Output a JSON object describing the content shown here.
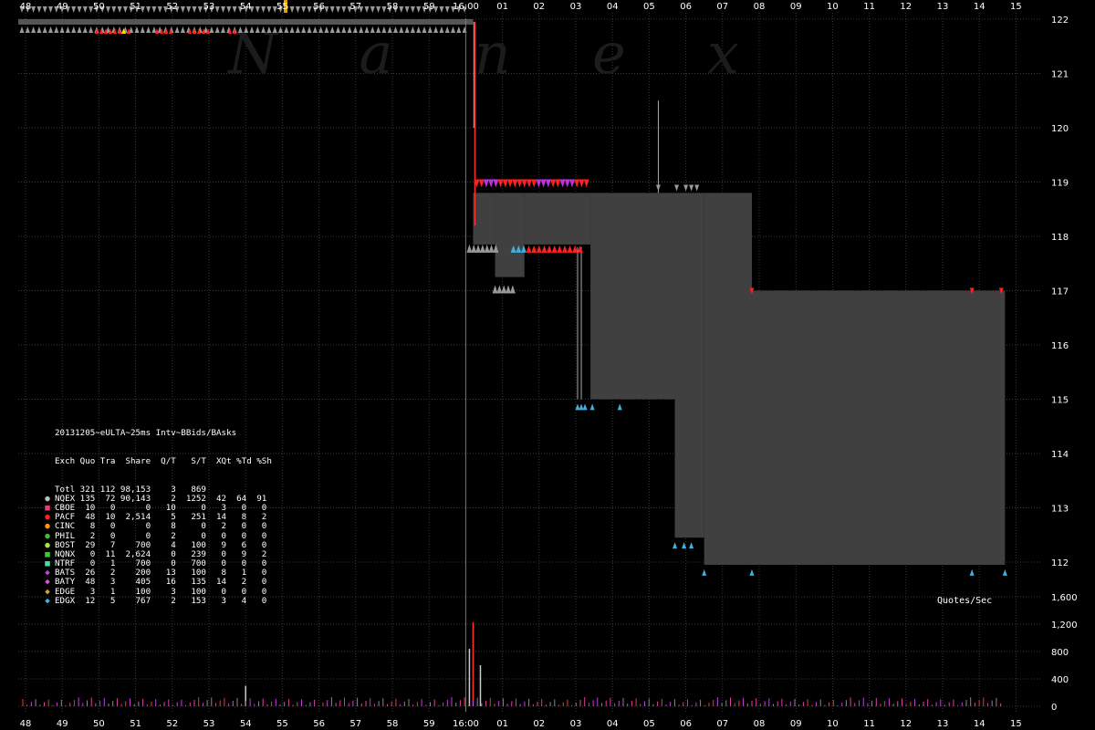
{
  "chart_data": {
    "type": "scatter",
    "title": "",
    "watermark": "Nanex",
    "x_tick_labels": [
      "48",
      "49",
      "50",
      "51",
      "52",
      "53",
      "54",
      "55",
      "56",
      "57",
      "58",
      "59",
      "16:00",
      "01",
      "02",
      "03",
      "04",
      "05",
      "06",
      "07",
      "08",
      "09",
      "10",
      "11",
      "12",
      "13",
      "14",
      "15"
    ],
    "y_tick_labels": [
      "122",
      "121",
      "120",
      "119",
      "118",
      "117",
      "116",
      "115",
      "114",
      "113",
      "112"
    ],
    "volume_tick_labels": [
      "1,600",
      "1,200",
      "800",
      "400",
      "0"
    ],
    "price_ylim": [
      112,
      122
    ],
    "volume_ylim": [
      0,
      1600
    ],
    "nbbo": {
      "bid_steps": [
        {
          "from": "16:00:00.2",
          "to": "16:00:00.8",
          "bid": 117.85,
          "ask": 118.8
        },
        {
          "from": "16:00:00.8",
          "to": "16:00:01.6",
          "bid": 117.25,
          "ask": 118.8
        },
        {
          "from": "16:00:01.6",
          "to": "16:00:03.4",
          "bid": 117.85,
          "ask": 118.8
        },
        {
          "from": "16:00:03.4",
          "to": "16:00:05.7",
          "bid": 115.0,
          "ask": 118.8
        },
        {
          "from": "16:00:05.7",
          "to": "16:00:06.5",
          "bid": 112.45,
          "ask": 118.8
        },
        {
          "from": "16:00:06.5",
          "to": "16:00:07.8",
          "bid": 111.95,
          "ask": 118.8
        },
        {
          "from": "16:00:07.8",
          "to": "16:00:14.7",
          "bid": 111.95,
          "ask": 117.0
        }
      ]
    },
    "pre_close_price": 121.95,
    "volume_spikes": [
      {
        "x": "16:00:00.2",
        "value": 1230
      },
      {
        "x": "16:00:00.1",
        "value": 840
      },
      {
        "x": "16:00:00.4",
        "value": 600
      },
      {
        "x": "54.0",
        "value": 300
      }
    ]
  },
  "stats": {
    "header": "20131205~eULTA~25ms Intv~BBids/BAsks",
    "columns": "Exch Quo Tra  Share  Q/T   S/T  XQt %Td %Sh",
    "rows": [
      {
        "text": "Totl 321 112 98,153    3   869",
        "marker": "",
        "color": "#ffffff"
      },
      {
        "text": "NQEX 135  72 90,143    2  1252  42  64  91",
        "marker": "●",
        "color": "#bbbbbb"
      },
      {
        "text": "CBOE  10   0      0   10     0   3   0   0",
        "marker": "■",
        "color": "#e0407a"
      },
      {
        "text": "PACF  48  10  2,514    5   251  14   8   2",
        "marker": "●",
        "color": "#ff2020"
      },
      {
        "text": "CINC   8   0      0    8     0   2   0   0",
        "marker": "●",
        "color": "#ff9a00"
      },
      {
        "text": "PHIL   2   0      0    2     0   0   0   0",
        "marker": "●",
        "color": "#40c040"
      },
      {
        "text": "BOST  29   7    700    4   100   9   6   0",
        "marker": "●",
        "color": "#b0e040"
      },
      {
        "text": "NQNX   0  11  2,624    0   239   0   9   2",
        "marker": "■",
        "color": "#30d030"
      },
      {
        "text": "NTRF   0   1    700    0   700   0   0   0",
        "marker": "■",
        "color": "#40e0a0"
      },
      {
        "text": "BATS  26   2    200   13   100   8   1   0",
        "marker": "◆",
        "color": "#c040e0"
      },
      {
        "text": "BATY  48   3    405   16   135  14   2   0",
        "marker": "◆",
        "color": "#e050e0"
      },
      {
        "text": "EDGE   3   1    100    3   100   0   0   0",
        "marker": "◆",
        "color": "#e0a030"
      },
      {
        "text": "EDGX  12   5    767    2   153   3   4   0",
        "marker": "◆",
        "color": "#40b0e0"
      }
    ]
  },
  "quotes_label": "Quotes/Sec",
  "colors": {
    "nbbo_fill": "#404040",
    "grid": "#3a3a3a",
    "bid_marker": "#40b0e0",
    "ask_marker_pacf": "#ff2020",
    "ask_marker_baty": "#c030e0",
    "nqex_marker": "#999999"
  }
}
